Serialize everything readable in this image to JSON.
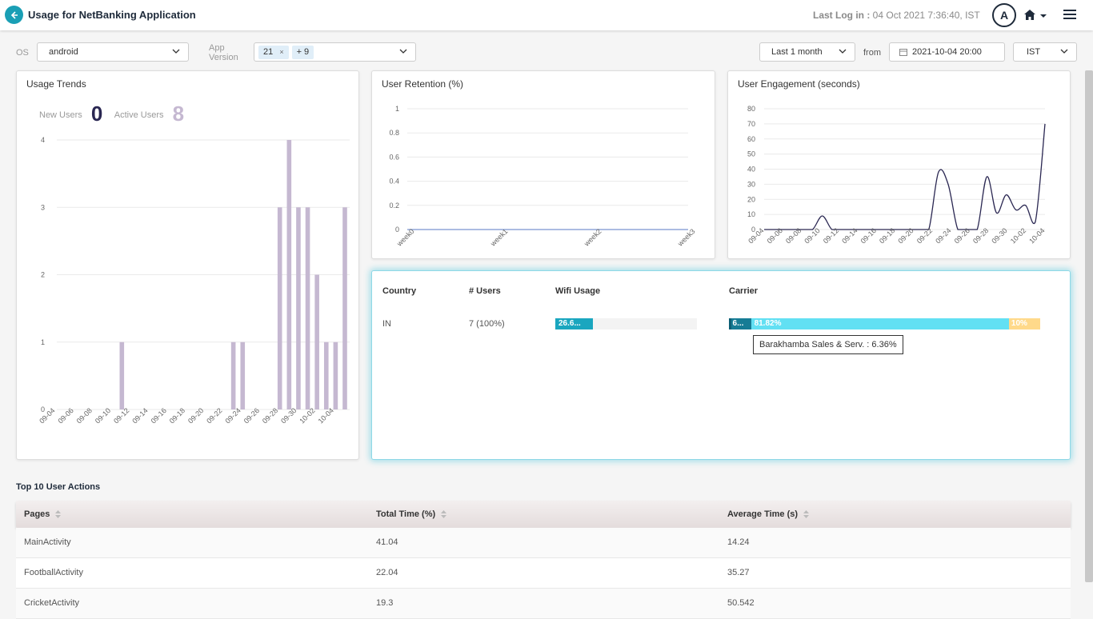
{
  "header": {
    "title": "Usage for NetBanking Application",
    "last_log_label": "Last Log in :",
    "last_log_value": "04 Oct 2021 7:36:40, IST",
    "avatar_initial": "A"
  },
  "filters": {
    "os_label": "OS",
    "os_value": "android",
    "app_version_label_1": "App",
    "app_version_label_2": "Version",
    "app_version_chip": "21",
    "app_version_chip_remove": "×",
    "app_version_more": "+ 9",
    "range_value": "Last 1 month",
    "from_label": "from",
    "from_value": "2021-10-04 20:00",
    "tz_value": "IST"
  },
  "usage_trends": {
    "title": "Usage Trends",
    "new_users_label": "New Users",
    "new_users_value": "0",
    "active_users_label": "Active Users",
    "active_users_value": "8"
  },
  "user_retention": {
    "title": "User Retention (%)"
  },
  "user_engagement": {
    "title": "User Engagement (seconds)"
  },
  "country_table": {
    "headers": {
      "country": "Country",
      "users": "# Users",
      "wifi": "Wifi Usage",
      "carrier": "Carrier"
    },
    "row": {
      "country": "IN",
      "users": "7 (100%)",
      "wifi_label": "26.6...",
      "wifi_fraction": 0.266,
      "carrier_seg1_label": "6...",
      "carrier_seg2_label": "81.82%",
      "carrier_seg3_label": "10%",
      "carrier_fractions": [
        0.0064,
        0.0636,
        0.8182,
        0.1
      ]
    },
    "tooltip": "Barakhamba Sales & Serv. : 6.36%"
  },
  "top_actions": {
    "title": "Top 10 User Actions",
    "headers": [
      "Pages",
      "Total Time (%)",
      "Average Time (s)"
    ],
    "rows": [
      [
        "MainActivity",
        "41.04",
        "14.24"
      ],
      [
        "FootballActivity",
        "22.04",
        "35.27"
      ],
      [
        "CricketActivity",
        "19.3",
        "50.542"
      ]
    ]
  },
  "colors": {
    "accent": "#1a9fb5",
    "bar": "#c5b8d1",
    "line": "#2a2752",
    "wifi": "#1aa6bf",
    "carrier_dark": "#167c95",
    "carrier_main": "#62e0f3",
    "carrier_other": "#ffd98a"
  },
  "chart_data": [
    {
      "type": "bar",
      "title": "Usage Trends",
      "categories": [
        "09-04",
        "09-05",
        "09-06",
        "09-07",
        "09-08",
        "09-09",
        "09-10",
        "09-11",
        "09-12",
        "09-13",
        "09-14",
        "09-15",
        "09-16",
        "09-17",
        "09-18",
        "09-19",
        "09-20",
        "09-21",
        "09-22",
        "09-23",
        "09-24",
        "09-25",
        "09-26",
        "09-27",
        "09-28",
        "09-29",
        "09-30",
        "10-01",
        "10-02",
        "10-03",
        "10-04"
      ],
      "tick_labels": [
        "09-04",
        "09-06",
        "09-08",
        "09-10",
        "09-12",
        "09-14",
        "09-16",
        "09-18",
        "09-20",
        "09-22",
        "09-24",
        "09-26",
        "09-28",
        "09-30",
        "10-02",
        "10-04"
      ],
      "values": [
        0,
        0,
        0,
        0,
        0,
        0,
        0,
        1,
        0,
        0,
        0,
        0,
        0,
        0,
        0,
        0,
        0,
        0,
        0,
        1,
        1,
        0,
        0,
        0,
        3,
        4,
        3,
        3,
        2,
        1,
        1,
        3
      ],
      "yticks": [
        0,
        1,
        2,
        3,
        4
      ],
      "ylim": [
        0,
        4
      ],
      "grid": true
    },
    {
      "type": "line",
      "title": "User Retention (%)",
      "categories": [
        "week0",
        "week1",
        "week2",
        "week3"
      ],
      "values": [
        0,
        0,
        0,
        0
      ],
      "yticks": [
        0,
        0.2,
        0.4,
        0.6,
        0.8,
        1
      ],
      "ylim": [
        0,
        1
      ],
      "grid": true
    },
    {
      "type": "line",
      "title": "User Engagement (seconds)",
      "categories": [
        "09-04",
        "09-05",
        "09-06",
        "09-07",
        "09-08",
        "09-09",
        "09-10",
        "09-11",
        "09-12",
        "09-13",
        "09-14",
        "09-15",
        "09-16",
        "09-17",
        "09-18",
        "09-19",
        "09-20",
        "09-21",
        "09-22",
        "09-23",
        "09-24",
        "09-25",
        "09-26",
        "09-27",
        "09-28",
        "09-29",
        "09-30",
        "10-01",
        "10-02",
        "10-03",
        "10-04"
      ],
      "tick_labels": [
        "09-04",
        "09-06",
        "09-08",
        "09-10",
        "09-12",
        "09-14",
        "09-16",
        "09-18",
        "09-20",
        "09-22",
        "09-24",
        "09-26",
        "09-28",
        "09-30",
        "10-02",
        "10-04"
      ],
      "values": [
        0,
        0,
        0,
        0,
        0,
        0,
        9,
        0,
        0,
        0,
        0,
        0,
        0,
        0,
        0,
        0,
        0,
        0,
        38,
        30,
        0,
        0,
        0,
        35,
        11,
        23,
        13,
        16,
        5,
        70
      ],
      "yticks": [
        0,
        10,
        20,
        30,
        40,
        50,
        60,
        70,
        80
      ],
      "ylim": [
        0,
        80
      ],
      "grid": true
    }
  ]
}
